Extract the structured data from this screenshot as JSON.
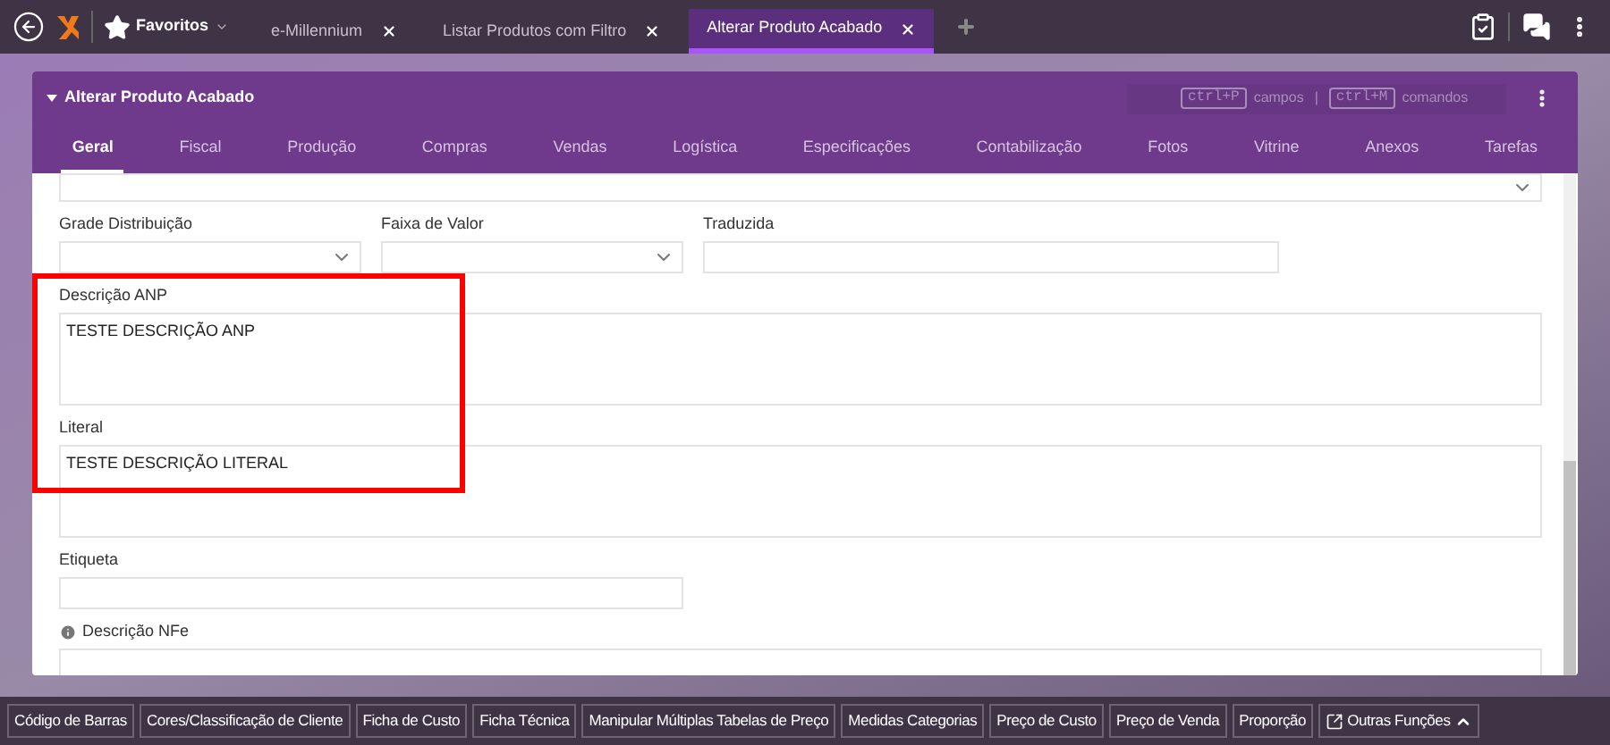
{
  "topbar": {
    "favorites": "Favoritos",
    "tabs": [
      {
        "label": "e-Millennium",
        "selected": false
      },
      {
        "label": "Listar Produtos com Filtro",
        "selected": false
      },
      {
        "label": "Alterar Produto Acabado",
        "selected": true
      }
    ]
  },
  "panel": {
    "title": "Alterar Produto Acabado",
    "expanded": true,
    "shortcuts": [
      {
        "key": "ctrl+P",
        "label": "campos"
      },
      {
        "key": "ctrl+M",
        "label": "comandos"
      }
    ],
    "separator": "|",
    "tabs": [
      {
        "label": "Geral",
        "selected": true
      },
      {
        "label": "Fiscal",
        "selected": false
      },
      {
        "label": "Produção",
        "selected": false
      },
      {
        "label": "Compras",
        "selected": false
      },
      {
        "label": "Vendas",
        "selected": false
      },
      {
        "label": "Logística",
        "selected": false
      },
      {
        "label": "Especificações",
        "selected": false
      },
      {
        "label": "Contabilização",
        "selected": false
      },
      {
        "label": "Fotos",
        "selected": false
      },
      {
        "label": "Vitrine",
        "selected": false
      },
      {
        "label": "Anexos",
        "selected": false
      },
      {
        "label": "Tarefas",
        "selected": false
      }
    ]
  },
  "form": {
    "rows": [
      [
        {
          "kind": "select"
        }
      ],
      [
        {
          "kind": "select",
          "label": "Grade Distribuição"
        },
        {
          "kind": "select",
          "label": "Faixa de Valor"
        },
        {
          "kind": "input",
          "label": "Traduzida"
        }
      ],
      [
        {
          "kind": "textarea",
          "label": "Descrição ANP",
          "value": "TESTE DESCRIÇÃO ANP"
        }
      ],
      [
        {
          "kind": "textarea",
          "label": "Literal",
          "value": "TESTE DESCRIÇÃO LITERAL"
        }
      ],
      [
        {
          "kind": "input",
          "label": "Etiqueta"
        }
      ],
      [
        {
          "kind": "textarea",
          "label": "Descrição NFe",
          "info": true
        }
      ]
    ]
  },
  "bottom_bar": {
    "buttons": [
      "Código de Barras",
      "Cores/Classificação de Cliente",
      "Ficha de Custo",
      "Ficha Técnica",
      "Manipular Múltiplas Tabelas de Preço",
      "Medidas Categorias",
      "Preço de Custo",
      "Preço de Venda",
      "Proporção"
    ],
    "more": "Outras Funções"
  }
}
